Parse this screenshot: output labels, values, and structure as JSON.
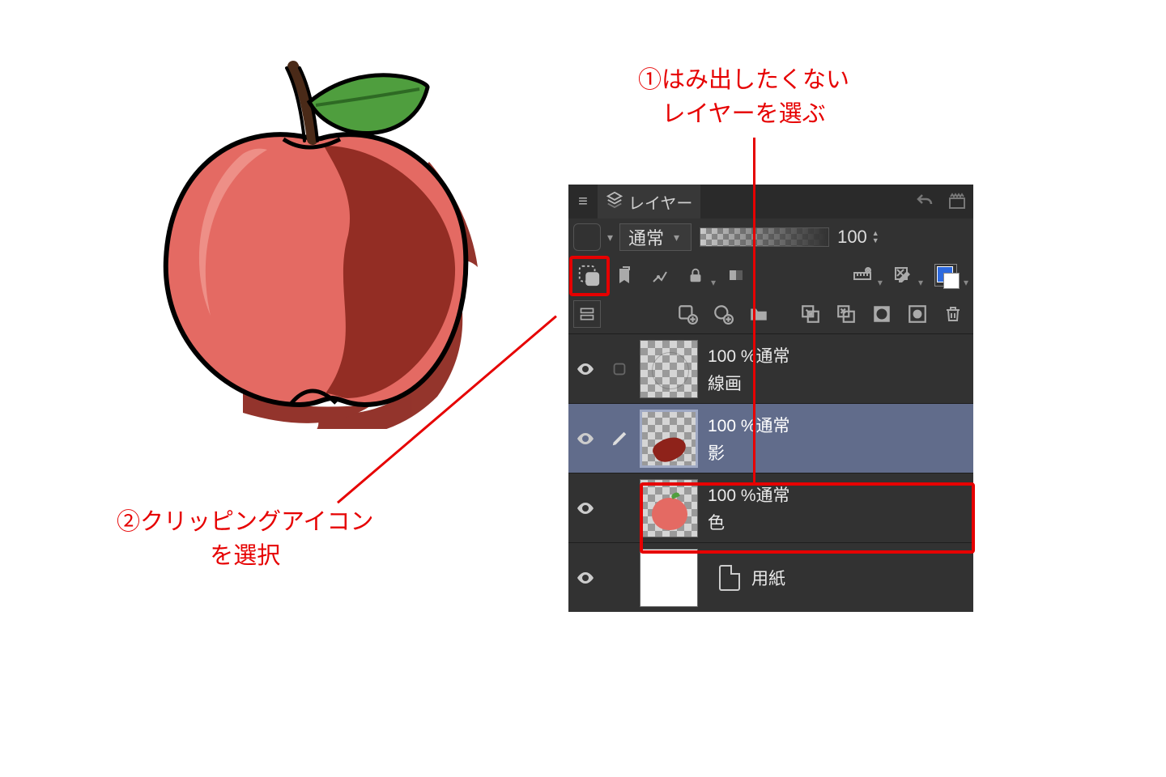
{
  "annotations": {
    "step1": "①はみ出したくない\nレイヤーを選ぶ",
    "step2": "②クリッピングアイコン\nを選択"
  },
  "panel": {
    "title": "レイヤー",
    "blend_mode": "通常",
    "opacity": "100"
  },
  "layers": [
    {
      "opacity_label": "100 %通常",
      "name": "線画"
    },
    {
      "opacity_label": "100 %通常",
      "name": "影"
    },
    {
      "opacity_label": "100 %通常",
      "name": "色"
    },
    {
      "opacity_label": "",
      "name": "用紙"
    }
  ]
}
